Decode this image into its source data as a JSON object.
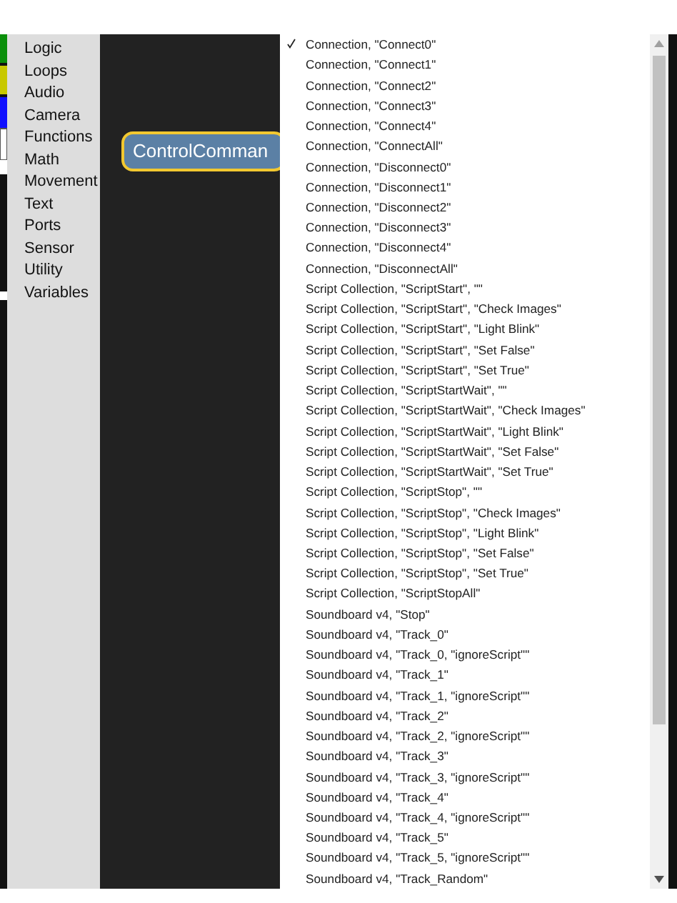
{
  "toolbox": {
    "categories": [
      "Logic",
      "Loops",
      "Audio",
      "Camera",
      "Functions",
      "Math",
      "Movement",
      "Text",
      "Ports",
      "Sensor",
      "Utility",
      "Variables"
    ]
  },
  "workspace": {
    "block": {
      "label": "ControlComman"
    }
  },
  "dropdown": {
    "options": [
      {
        "label": "Connection, \"Connect0\"",
        "selected": true
      },
      {
        "label": "Connection, \"Connect1\"",
        "selected": false
      },
      {
        "label": "Connection, \"Connect2\"",
        "selected": false
      },
      {
        "label": "Connection, \"Connect3\"",
        "selected": false
      },
      {
        "label": "Connection, \"Connect4\"",
        "selected": false
      },
      {
        "label": "Connection, \"ConnectAll\"",
        "selected": false
      },
      {
        "label": "Connection, \"Disconnect0\"",
        "selected": false
      },
      {
        "label": "Connection, \"Disconnect1\"",
        "selected": false
      },
      {
        "label": "Connection, \"Disconnect2\"",
        "selected": false
      },
      {
        "label": "Connection, \"Disconnect3\"",
        "selected": false
      },
      {
        "label": "Connection, \"Disconnect4\"",
        "selected": false
      },
      {
        "label": "Connection, \"DisconnectAll\"",
        "selected": false
      },
      {
        "label": "Script Collection, \"ScriptStart\", \"\"",
        "selected": false
      },
      {
        "label": "Script Collection, \"ScriptStart\", \"Check Images\"",
        "selected": false
      },
      {
        "label": "Script Collection, \"ScriptStart\", \"Light Blink\"",
        "selected": false
      },
      {
        "label": "Script Collection, \"ScriptStart\", \"Set False\"",
        "selected": false
      },
      {
        "label": "Script Collection, \"ScriptStart\", \"Set True\"",
        "selected": false
      },
      {
        "label": "Script Collection, \"ScriptStartWait\", \"\"",
        "selected": false
      },
      {
        "label": "Script Collection, \"ScriptStartWait\", \"Check Images\"",
        "selected": false
      },
      {
        "label": "Script Collection, \"ScriptStartWait\", \"Light Blink\"",
        "selected": false
      },
      {
        "label": "Script Collection, \"ScriptStartWait\", \"Set False\"",
        "selected": false
      },
      {
        "label": "Script Collection, \"ScriptStartWait\", \"Set True\"",
        "selected": false
      },
      {
        "label": "Script Collection, \"ScriptStop\", \"\"",
        "selected": false
      },
      {
        "label": "Script Collection, \"ScriptStop\", \"Check Images\"",
        "selected": false
      },
      {
        "label": "Script Collection, \"ScriptStop\", \"Light Blink\"",
        "selected": false
      },
      {
        "label": "Script Collection, \"ScriptStop\", \"Set False\"",
        "selected": false
      },
      {
        "label": "Script Collection, \"ScriptStop\", \"Set True\"",
        "selected": false
      },
      {
        "label": "Script Collection, \"ScriptStopAll\"",
        "selected": false
      },
      {
        "label": "Soundboard v4, \"Stop\"",
        "selected": false
      },
      {
        "label": "Soundboard v4, \"Track_0\"",
        "selected": false
      },
      {
        "label": "Soundboard v4, \"Track_0, \"ignoreScript\"\"",
        "selected": false
      },
      {
        "label": "Soundboard v4, \"Track_1\"",
        "selected": false
      },
      {
        "label": "Soundboard v4, \"Track_1, \"ignoreScript\"\"",
        "selected": false
      },
      {
        "label": "Soundboard v4, \"Track_2\"",
        "selected": false
      },
      {
        "label": "Soundboard v4, \"Track_2, \"ignoreScript\"\"",
        "selected": false
      },
      {
        "label": "Soundboard v4, \"Track_3\"",
        "selected": false
      },
      {
        "label": "Soundboard v4, \"Track_3, \"ignoreScript\"\"",
        "selected": false
      },
      {
        "label": "Soundboard v4, \"Track_4\"",
        "selected": false
      },
      {
        "label": "Soundboard v4, \"Track_4, \"ignoreScript\"\"",
        "selected": false
      },
      {
        "label": "Soundboard v4, \"Track_5\"",
        "selected": false
      },
      {
        "label": "Soundboard v4, \"Track_5, \"ignoreScript\"\"",
        "selected": false
      },
      {
        "label": "Soundboard v4, \"Track_Random\"",
        "selected": false
      }
    ]
  }
}
